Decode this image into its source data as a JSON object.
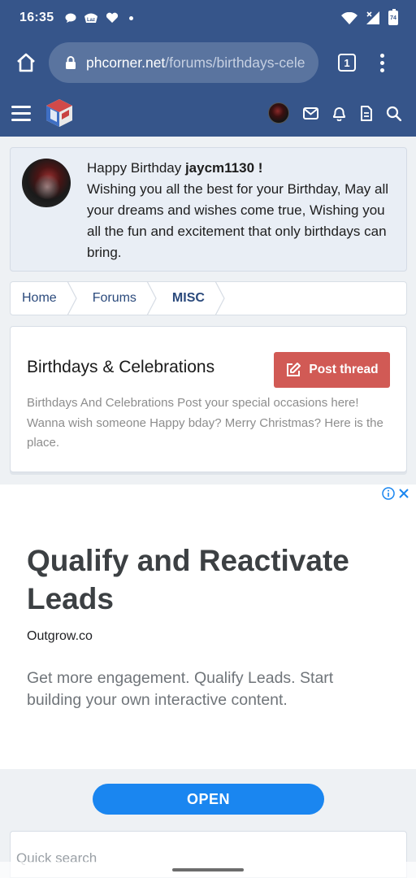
{
  "status_bar": {
    "time": "16:35",
    "battery": "74",
    "icons": [
      "chat-bubble-icon",
      "laz-icon",
      "heart-icon",
      "wifi-icon",
      "signal-icon",
      "battery-icon"
    ]
  },
  "browser": {
    "url_domain": "phcorner.net",
    "url_path": "/forums/birthdays-cele",
    "tab_count": "1"
  },
  "birthday_notice": {
    "greeting": "Happy Birthday ",
    "username": "jaycm1130 !",
    "message": "Wishing you all the best for your Birthday, May all your dreams and wishes come true, Wishing you all the fun and excitement that only birthdays can bring."
  },
  "breadcrumb": {
    "items": [
      "Home",
      "Forums",
      "MISC"
    ]
  },
  "forum": {
    "title": "Birthdays & Celebrations",
    "post_thread_label": "Post thread",
    "description": "Birthdays And Celebrations Post your special occasions here! Wanna wish someone Happy bday? Merry Christmas? Here is the place."
  },
  "ad": {
    "headline": "Qualify and Reactivate Leads",
    "domain": "Outgrow.co",
    "body": "Get more engagement. Qualify Leads. Start building your own interactive content.",
    "cta": "OPEN"
  },
  "quick_search": {
    "label": "Quick search"
  },
  "colors": {
    "brand_header": "#36558a",
    "post_thread": "#d15a55",
    "ad_cta": "#1a86f0",
    "link": "#2b4a7c"
  }
}
